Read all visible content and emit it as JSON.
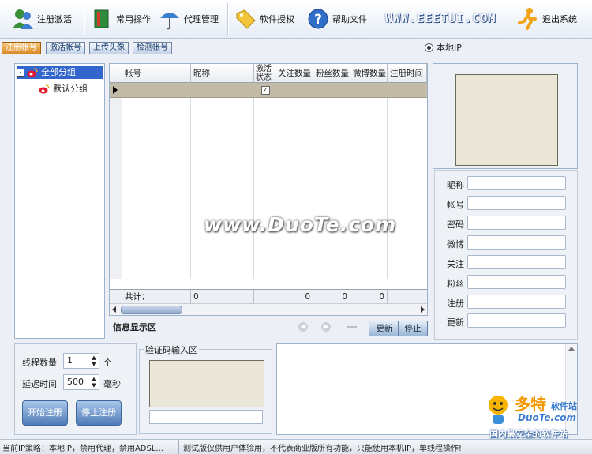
{
  "toolbar": {
    "register_activate": "注册激活",
    "common_ops": "常用操作",
    "proxy_mgmt": "代理管理",
    "software_auth": "软件授权",
    "help_file": "帮助文件",
    "brand": "WWW.EEETUI.COM",
    "exit": "退出系统"
  },
  "tabs": [
    "注册帐号",
    "激活帐号",
    "上传头像",
    "检测帐号"
  ],
  "ip_option": "本地IP",
  "tree": {
    "root": "全部分组",
    "child": "默认分组"
  },
  "grid": {
    "headers": [
      "帐号",
      "昵称",
      "激活状态",
      "关注数量",
      "粉丝数量",
      "微博数量",
      "注册时间"
    ],
    "summary": {
      "label": "共计：",
      "nick": "0",
      "follow": "0",
      "fans": "0",
      "weibo": "0"
    }
  },
  "info": {
    "title": "信息显示区",
    "refresh": "更新",
    "stop": "停止"
  },
  "fields": [
    "昵称",
    "帐号",
    "密码",
    "微博",
    "关注",
    "粉丝",
    "注册",
    "更新"
  ],
  "settings": {
    "thread_label": "线程数量",
    "thread_value": "1",
    "thread_unit": "个",
    "delay_label": "延迟时间",
    "delay_value": "500",
    "delay_unit": "毫秒",
    "start": "开始注册",
    "stop": "停止注册"
  },
  "captcha": {
    "title": "验证码输入区"
  },
  "watermark": "www.DuoTe.com",
  "corner_logo": {
    "name": "多特",
    "sub": "软件站",
    "url": "DuoTe.com",
    "slogan": "国内最安全的软件站"
  },
  "status": {
    "left": "当前IP策略：本地IP，禁用代理，禁用ADSL...",
    "right": "测试版仅供用户体验用，不代表商业版所有功能，只能使用本机IP，单线程操作!"
  }
}
